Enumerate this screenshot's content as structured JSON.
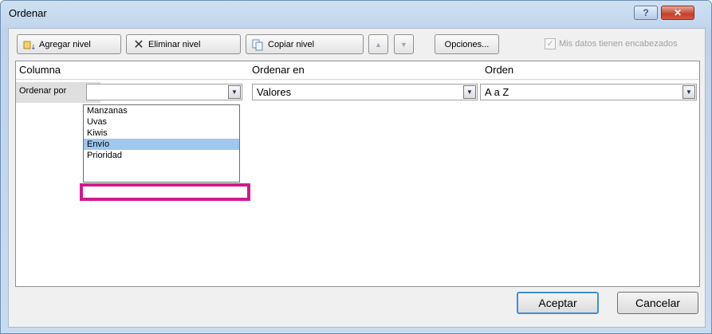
{
  "window": {
    "title": "Ordenar",
    "help_label": "?",
    "close_label": "✕"
  },
  "toolbar": {
    "add_level": "Agregar nivel",
    "delete_level": "Eliminar nivel",
    "copy_level": "Copiar nivel",
    "move_up": "▲",
    "move_down": "▼",
    "options": "Opciones...",
    "headers_checkbox": "Mis datos tienen encabezados",
    "headers_checked": true
  },
  "grid": {
    "headers": [
      "Columna",
      "Ordenar en",
      "Orden"
    ],
    "row": {
      "label": "Ordenar por",
      "column_value": "",
      "sort_on_value": "Valores",
      "order_value": "A a Z"
    }
  },
  "dropdown": {
    "options": [
      "Manzanas",
      "Uvas",
      "Kiwis",
      "Envío",
      "Prioridad"
    ],
    "selected": "Envío"
  },
  "colors": {
    "highlight": "#d01a8f",
    "selection": "#9fc7ef"
  },
  "footer": {
    "ok": "Aceptar",
    "cancel": "Cancelar"
  }
}
